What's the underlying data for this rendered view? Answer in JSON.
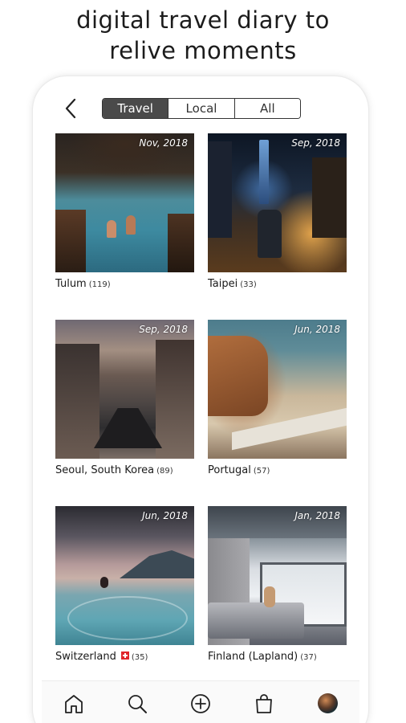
{
  "headline": {
    "line1": "digital travel diary to",
    "line2": "relive moments"
  },
  "header": {
    "back_icon": "chevron-left-icon",
    "tabs": [
      {
        "label": "Travel",
        "active": true
      },
      {
        "label": "Local",
        "active": false
      },
      {
        "label": "All",
        "active": false
      }
    ]
  },
  "albums": [
    {
      "name": "Tulum",
      "count": "(119)",
      "date": "Nov, 2018"
    },
    {
      "name": "Taipei",
      "count": "(33)",
      "date": "Sep, 2018"
    },
    {
      "name": "Seoul, South Korea",
      "count": "(89)",
      "date": "Sep, 2018"
    },
    {
      "name": "Portugal",
      "count": "(57)",
      "date": "Jun, 2018"
    },
    {
      "name": "Switzerland",
      "count": "(35)",
      "date": "Jun, 2018",
      "flag": "swiss-flag"
    },
    {
      "name": "Finland (Lapland)",
      "count": "(37)",
      "date": "Jan, 2018"
    }
  ],
  "bottom_nav": {
    "items": [
      "home-icon",
      "search-icon",
      "add-icon",
      "shopping-bag-icon",
      "profile-avatar"
    ]
  },
  "colors": {
    "active_tab_bg": "#4a4a4a",
    "text": "#1a1a1a",
    "flag_red": "#e0262b"
  }
}
